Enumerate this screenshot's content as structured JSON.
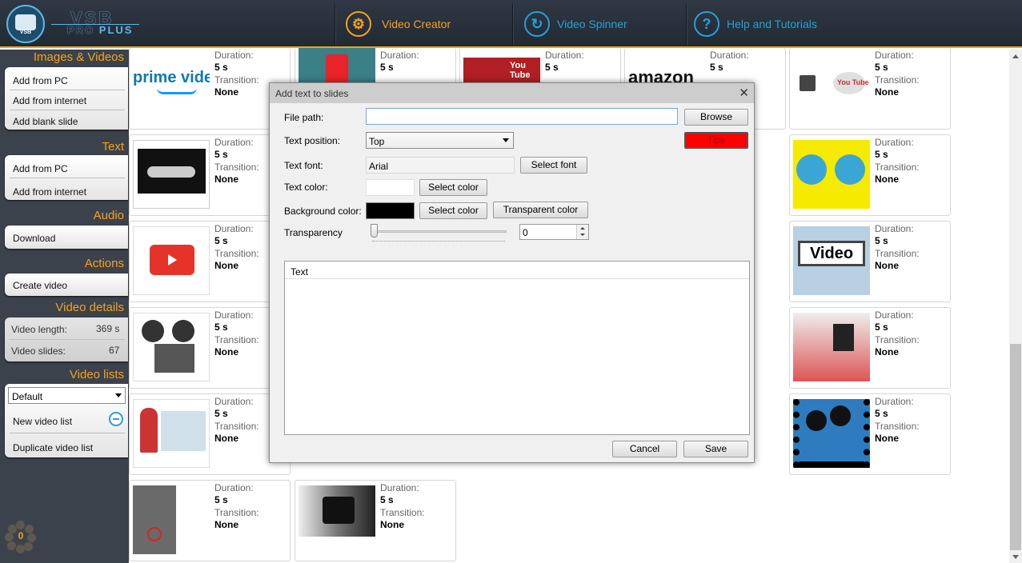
{
  "header": {
    "brand_line1": "VSB",
    "brand_line2a": "PRO",
    "brand_line2b": "PLUS",
    "logo_text": "VSB",
    "nav": [
      {
        "label": "Video Creator",
        "icon": "gear-icon",
        "color": "#f5a21b"
      },
      {
        "label": "Video Spinner",
        "icon": "refresh-icon",
        "color": "#2a9fd8"
      },
      {
        "label": "Help and Tutorials",
        "icon": "question-icon",
        "color": "#2a9fd8"
      }
    ]
  },
  "sidebar": {
    "images_videos": {
      "title": "Images & Videos",
      "items": [
        "Add from PC",
        "Add from internet",
        "Add blank slide"
      ]
    },
    "text": {
      "title": "Text",
      "items": [
        "Add from PC",
        "Add from internet"
      ]
    },
    "audio": {
      "title": "Audio",
      "items": [
        "Download"
      ]
    },
    "actions": {
      "title": "Actions",
      "items": [
        "Create video"
      ]
    },
    "video_details": {
      "title": "Video details",
      "length_label": "Video length:",
      "length_value": "369 s",
      "slides_label": "Video slides:",
      "slides_value": "67"
    },
    "video_lists": {
      "title": "Video lists",
      "selected": "Default",
      "new_label": "New video list",
      "duplicate_label": "Duplicate video list"
    },
    "counter": "0"
  },
  "slide_labels": {
    "duration": "Duration:",
    "transition": "Transition:"
  },
  "slides": [
    {
      "id": "s1",
      "duration": "5 s",
      "transition": "None",
      "thumb": "prime video"
    },
    {
      "id": "s2",
      "duration": "5 s",
      "transition": "None",
      "thumb": ""
    },
    {
      "id": "s3",
      "duration": "5 s",
      "transition": "None",
      "thumb": "You Tube"
    },
    {
      "id": "s4",
      "duration": "5 s",
      "transition": "None",
      "thumb": "amazon"
    },
    {
      "id": "s5",
      "duration": "5 s",
      "transition": "None",
      "thumb": "You Tube"
    },
    {
      "id": "s6",
      "duration": "5 s",
      "transition": "None",
      "thumb": ""
    },
    {
      "id": "s7",
      "duration": "5 s",
      "transition": "None",
      "thumb": ""
    },
    {
      "id": "s8",
      "duration": "5 s",
      "transition": "None",
      "thumb": ""
    },
    {
      "id": "s9",
      "duration": "5 s",
      "transition": "None",
      "thumb": "Video"
    },
    {
      "id": "s10",
      "duration": "5 s",
      "transition": "None",
      "thumb": ""
    },
    {
      "id": "s11",
      "duration": "5 s",
      "transition": "None",
      "thumb": ""
    },
    {
      "id": "s12",
      "duration": "5 s",
      "transition": "None",
      "thumb": ""
    },
    {
      "id": "s13",
      "duration": "5 s",
      "transition": "None",
      "thumb": ""
    },
    {
      "id": "s14",
      "duration": "5 s",
      "transition": "None",
      "thumb": ""
    },
    {
      "id": "s15",
      "duration": "5 s",
      "transition": "None",
      "thumb": ""
    }
  ],
  "dialog": {
    "title": "Add text to slides",
    "file_path_label": "File path:",
    "file_path_value": "",
    "browse": "Browse",
    "tips": "Tips",
    "text_position_label": "Text position:",
    "text_position_value": "Top",
    "text_font_label": "Text font:",
    "text_font_value": "Arial",
    "select_font": "Select font",
    "text_color_label": "Text color:",
    "text_color_value": "#ffffff",
    "select_color": "Select color",
    "bg_color_label": "Background color:",
    "bg_color_value": "#000000",
    "transparent_color": "Transparent color",
    "transparency_label": "Transparency",
    "transparency_value": "0",
    "text_header": "Text",
    "cancel": "Cancel",
    "save": "Save"
  },
  "colors": {
    "accent": "#f5a21b",
    "blue": "#2a9fd8",
    "sidebar": "#3c424b",
    "tips": "#ff0000"
  }
}
